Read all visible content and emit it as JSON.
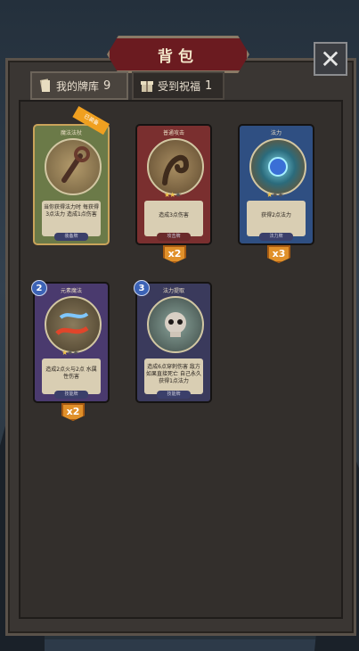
{
  "title": "背包",
  "close_symbol": "✕",
  "tabs": [
    {
      "label": "我的牌库",
      "count": "9",
      "icon": "cards-icon",
      "active": true
    },
    {
      "label": "受到祝福",
      "count": "1",
      "icon": "gift-icon",
      "active": false
    }
  ],
  "cards": [
    {
      "name": "魔法法杖",
      "desc": "当你获得法力时 每获得3点法力 造成1点伤害",
      "tag": "装备牌",
      "ribbon": "已装备",
      "stars": 0,
      "cost": "",
      "count": ""
    },
    {
      "name": "普通攻击",
      "desc": "造成3点伤害",
      "tag": "攻击牌",
      "ribbon": "",
      "stars": 2,
      "cost": "",
      "count": "x2"
    },
    {
      "name": "法力",
      "desc": "获得2点法力",
      "tag": "法力牌",
      "ribbon": "",
      "stars": 1,
      "cost": "",
      "count": "x3"
    },
    {
      "name": "元素魔法",
      "desc": "造成2点火与2点 水属性伤害",
      "tag": "技能牌",
      "ribbon": "",
      "stars": 1,
      "cost": "2",
      "count": "x2"
    },
    {
      "name": "法力提取",
      "desc": "造成6点穿刺伤害 敌方如果直接死亡 自己永久获得1点法力",
      "tag": "技能牌",
      "ribbon": "",
      "stars": 0,
      "cost": "3",
      "count": ""
    }
  ],
  "colors": {
    "card_frame_1": "#6b7a48",
    "card_frame_2": "#7a2f2f",
    "card_frame_3": "#2f4f82",
    "card_frame_4": "#4a3a6e",
    "card_frame_5": "#3a3a5c"
  }
}
